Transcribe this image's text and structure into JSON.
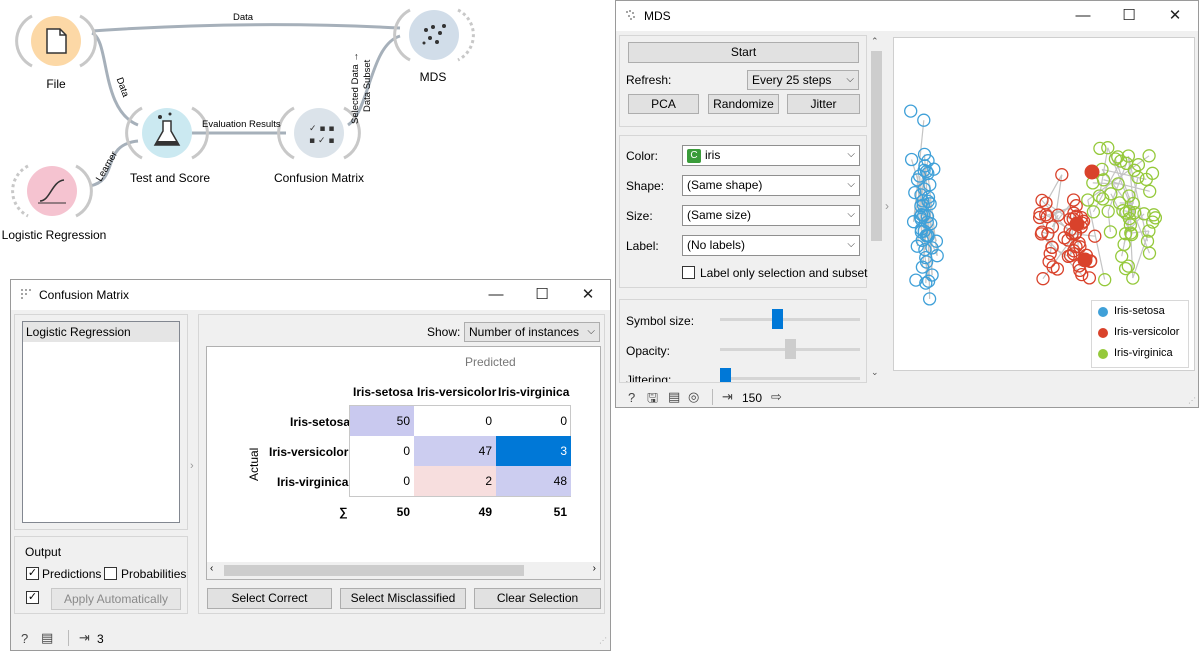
{
  "workflow": {
    "nodes": {
      "file": "File",
      "logreg": "Logistic Regression",
      "testscore": "Test and Score",
      "confusion": "Confusion Matrix",
      "mds": "MDS"
    },
    "links": {
      "file_mds": "Data",
      "file_test": "Data",
      "learner": "Learner",
      "eval": "Evaluation Results",
      "sel_line1": "Selected Data →",
      "sel_line2": "Data Subset"
    },
    "colors": {
      "file": "#fcd8a6",
      "logreg": "#f5c3d0",
      "testscore": "#cbe9f1",
      "confusion": "#dbe3ea",
      "mds": "#d1dde9"
    }
  },
  "confusion_window": {
    "title": "Confusion Matrix",
    "learners": [
      "Logistic Regression"
    ],
    "show_label": "Show:",
    "show_value": "Number of instances",
    "predicted_label": "Predicted",
    "actual_label": "Actual",
    "columns": [
      "Iris-setosa",
      "Iris-versicolor",
      "Iris-virginica"
    ],
    "rows": [
      {
        "label": "Iris-setosa",
        "values": [
          "50",
          "0",
          "0"
        ]
      },
      {
        "label": "Iris-versicolor",
        "values": [
          "0",
          "47",
          "3"
        ]
      },
      {
        "label": "Iris-virginica",
        "values": [
          "0",
          "2",
          "48"
        ]
      }
    ],
    "sum_label": "∑",
    "sums": [
      "50",
      "49",
      "51"
    ],
    "output_label": "Output",
    "predictions_label": "Predictions",
    "predictions_checked": true,
    "probabilities_label": "Probabilities",
    "probabilities_checked": false,
    "auto_checked": true,
    "apply_label": "Apply Automatically",
    "select_correct": "Select Correct",
    "select_misclassified": "Select Misclassified",
    "clear_selection": "Clear Selection",
    "status_count": "3"
  },
  "mds_window": {
    "title": "MDS",
    "start_label": "Start",
    "refresh_label": "Refresh:",
    "refresh_value": "Every 25 steps",
    "pca_label": "PCA",
    "randomize_label": "Randomize",
    "jitter_label": "Jitter",
    "color_label": "Color:",
    "color_value": "iris",
    "shape_label": "Shape:",
    "shape_value": "(Same shape)",
    "size_label": "Size:",
    "size_value": "(Same size)",
    "label_label": "Label:",
    "label_value": "(No labels)",
    "label_only_label": "Label only selection and subset",
    "label_only_checked": false,
    "symbol_size_label": "Symbol size:",
    "symbol_size_level": 0.4,
    "opacity_label": "Opacity:",
    "opacity_level": 0.5,
    "jittering_label": "Jittering:",
    "jittering_level": 0.0,
    "status_count": "150",
    "legend": [
      {
        "name": "Iris-setosa",
        "color": "#3fa0d8"
      },
      {
        "name": "Iris-versicolor",
        "color": "#d9422b"
      },
      {
        "name": "Iris-virginica",
        "color": "#95c93b"
      }
    ]
  }
}
